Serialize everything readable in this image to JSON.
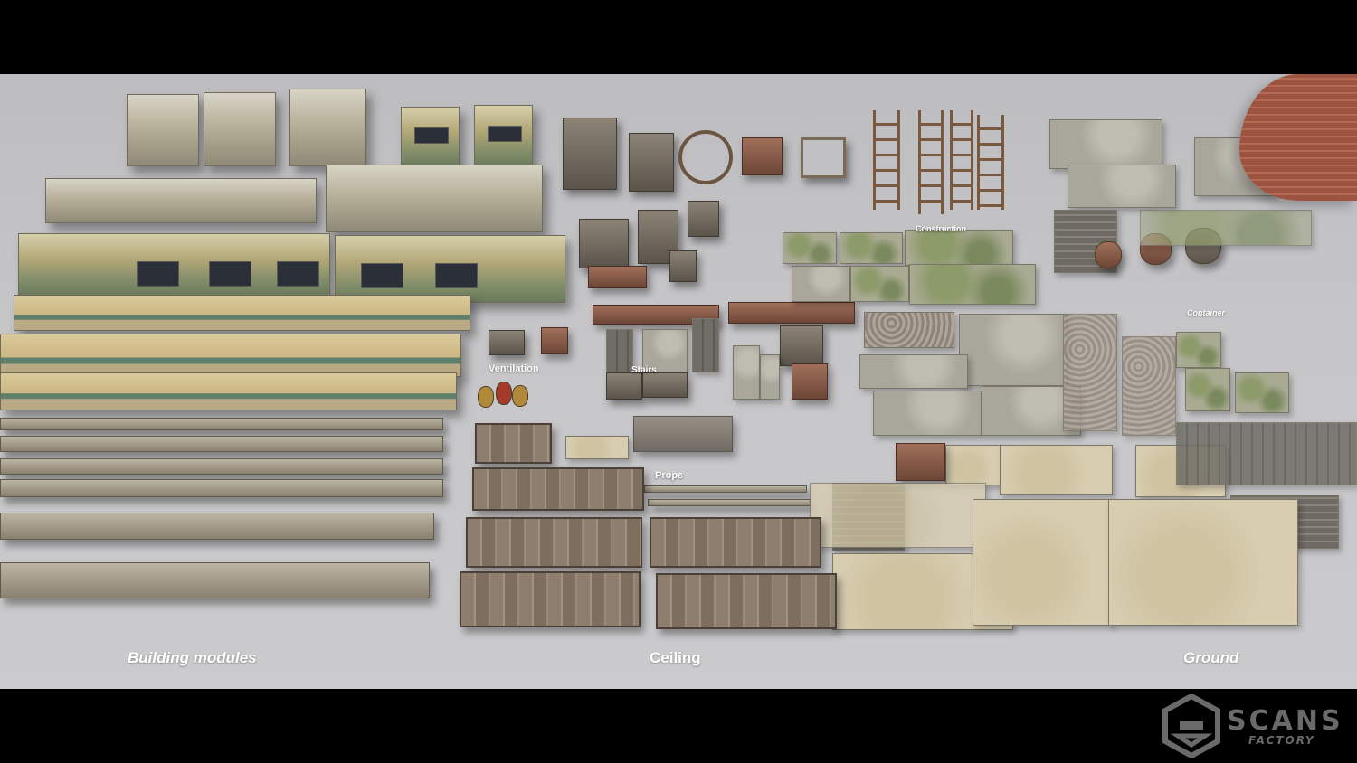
{
  "sections": {
    "building_modules": "Building modules",
    "ceiling": "Ceiling",
    "ground": "Ground"
  },
  "categories": {
    "ventilation": "Ventilation",
    "stairs": "Stairs",
    "props": "Props",
    "construction": "Construction",
    "container": "Container"
  },
  "logo": {
    "word": "SCANS",
    "sub": "FACTORY",
    "icon": "scans-factory-logo-icon"
  },
  "colors": {
    "background": "#c9c9cb",
    "letterbox": "#000000",
    "label": "#ffffff",
    "logo": "#6a6a6a"
  }
}
